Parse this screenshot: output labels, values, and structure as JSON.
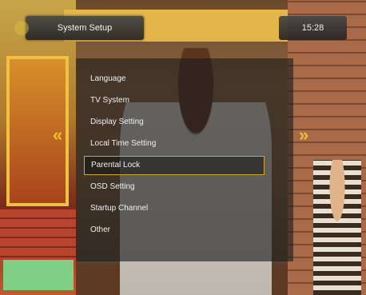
{
  "osd": {
    "title": "System Setup",
    "clock": "15:28"
  },
  "menu": {
    "items": [
      {
        "label": "Language"
      },
      {
        "label": "TV System"
      },
      {
        "label": "Display Setting"
      },
      {
        "label": "Local Time Setting"
      },
      {
        "label": "Parental Lock",
        "selected": true
      },
      {
        "label": "OSD Setting"
      },
      {
        "label": "Startup Channel"
      },
      {
        "label": "Other"
      }
    ]
  },
  "navigation": {
    "left_icon": "double-chevron-left-icon",
    "right_icon": "double-chevron-right-icon",
    "left_glyph": "«",
    "right_glyph": "»",
    "arrow_color": "#f0c030"
  },
  "colors": {
    "selection_border": "#caa83a",
    "text": "#f0f0f0"
  }
}
